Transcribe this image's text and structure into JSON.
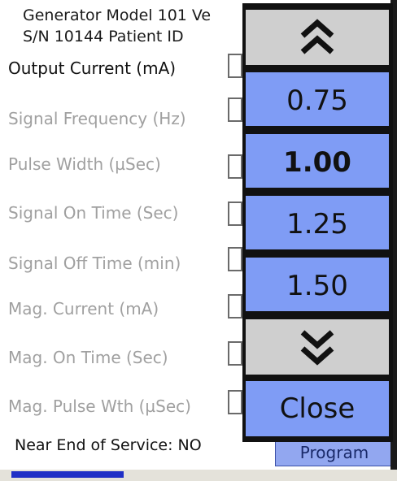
{
  "header": {
    "line1": "Generator Model 101 Ve",
    "line2": "S/N 10144  Patient ID"
  },
  "parameters": [
    {
      "label": "Output Current (mA)",
      "active": true
    },
    {
      "label": "Signal Frequency (Hz)",
      "active": false
    },
    {
      "label": "Pulse Width (µSec)",
      "active": false
    },
    {
      "label": "Signal On Time (Sec)",
      "active": false
    },
    {
      "label": "Signal Off Time (min)",
      "active": false
    },
    {
      "label": "Mag. Current (mA)",
      "active": false
    },
    {
      "label": "Mag. On Time (Sec)",
      "active": false
    },
    {
      "label": "Mag. Pulse Wth (µSec)",
      "active": false
    }
  ],
  "status": "Near End of Service: NO",
  "program_button": "Program",
  "picker": {
    "up_icon": "double-chevron-up-icon",
    "options": [
      "0.75",
      "1.00",
      "1.25",
      "1.50"
    ],
    "selected": "1.00",
    "down_icon": "double-chevron-down-icon",
    "close_label": "Close"
  },
  "progress": 0.3,
  "colors": {
    "picker_blue": "#7f9cf5",
    "picker_grey": "#cfcfcf",
    "program_button": "#92a7f0",
    "progress_fill": "#1f2fc6",
    "dim_text": "#a0a0a0"
  }
}
